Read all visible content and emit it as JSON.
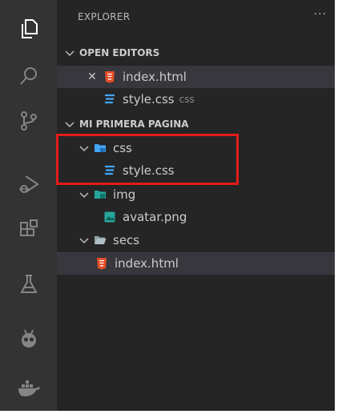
{
  "sidebar": {
    "header": "EXPLORER",
    "more": "···",
    "open_editors": {
      "title": "OPEN EDITORS",
      "items": [
        {
          "name": "index.html",
          "hint": ""
        },
        {
          "name": "style.css",
          "hint": "css"
        }
      ]
    },
    "workspace": {
      "title": "MI PRIMERA PAGINA",
      "css_folder": "css",
      "css_file": "style.css",
      "img_folder": "img",
      "img_file": "avatar.png",
      "secs_folder": "secs",
      "secs_file": "index.html"
    }
  },
  "activity_icons": [
    "explorer-icon",
    "search-icon",
    "source-control-icon",
    "run-debug-icon",
    "extensions-icon",
    "testing-icon",
    "platformio-icon",
    "docker-icon"
  ],
  "colors": {
    "activity_bar": "#333333",
    "sidebar": "#252526",
    "selection": "#37373d",
    "html_icon": "#e44d26",
    "css_icon": "#42a5f5",
    "image_icon": "#26a69a",
    "highlight": "#e31b1b"
  }
}
